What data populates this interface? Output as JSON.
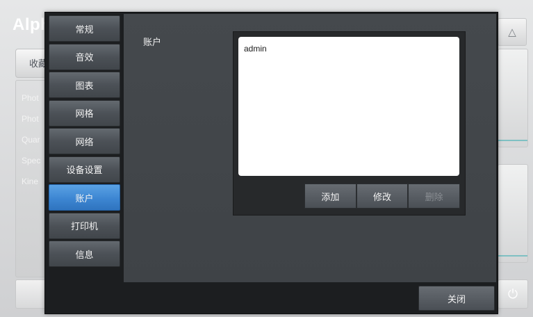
{
  "background": {
    "app_title": "Alph",
    "tab_label": "收藏",
    "list_items": [
      "Phot",
      "Phot",
      "Quar",
      "Spec",
      "Kine"
    ]
  },
  "dialog": {
    "nav": [
      {
        "label": "常规"
      },
      {
        "label": "音效"
      },
      {
        "label": "图表"
      },
      {
        "label": "网格"
      },
      {
        "label": "网络"
      },
      {
        "label": "设备设置"
      },
      {
        "label": "账户",
        "active": true
      },
      {
        "label": "打印机"
      },
      {
        "label": "信息"
      }
    ],
    "section_label": "账户",
    "accounts": [
      "admin"
    ],
    "buttons": {
      "add": "添加",
      "modify": "修改",
      "delete": "删除"
    },
    "close": "关闭"
  },
  "colors": {
    "active_nav": "#3d86d2",
    "dialog_bg": "#1c1e20",
    "content_bg": "#43474b"
  }
}
